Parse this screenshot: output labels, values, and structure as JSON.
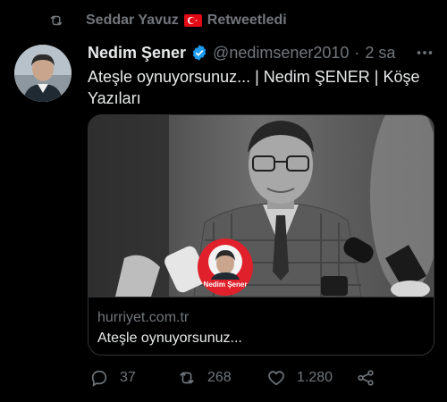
{
  "retweet": {
    "user": "Seddar Yavuz",
    "label": "Retweetledi",
    "icon": "retweet-icon"
  },
  "tweet": {
    "author_name": "Nedim Şener",
    "handle": "@nedimsener2010",
    "separator": "·",
    "time": "2 sa",
    "text": "Ateşle oynuyorsunuz... | Nedim ŞENER | Köşe Yazıları"
  },
  "card": {
    "badge_name": "Nedim Şener",
    "domain": "hurriyet.com.tr",
    "title": "Ateşle oynuyorsunuz..."
  },
  "actions": {
    "replies": "37",
    "retweets": "268",
    "likes": "1.280"
  },
  "colors": {
    "background": "#000000",
    "text": "#e7e9ea",
    "muted": "#71767b",
    "verified": "#1d9bf0",
    "border": "#2f3336",
    "badge_red": "#e0202a"
  }
}
